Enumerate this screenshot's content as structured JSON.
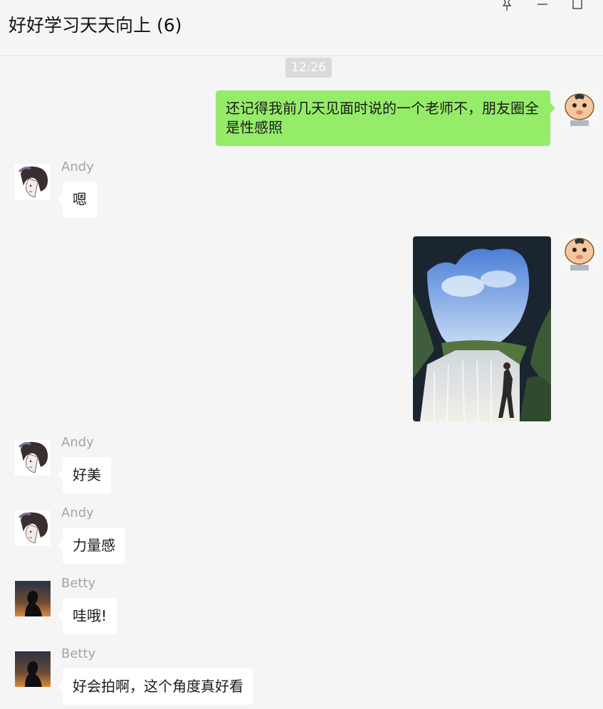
{
  "chat": {
    "title": "好好学习天天向上 (6)"
  },
  "window_controls": [
    "pin-icon",
    "minimize-icon",
    "maximize-icon"
  ],
  "timestamp": "12:26",
  "messages": [
    {
      "sender": "",
      "side": "right",
      "text": "还记得我前几天见面时说的一个老师不，朋友圈全是性感照"
    },
    {
      "sender": "Andy",
      "side": "left",
      "text": "嗯"
    },
    {
      "sender": "",
      "side": "right",
      "type": "image"
    },
    {
      "sender": "Andy",
      "side": "left",
      "text": "好美"
    },
    {
      "sender": "Andy",
      "side": "left",
      "text": "力量感"
    },
    {
      "sender": "Betty",
      "side": "left",
      "text": "哇哦!"
    },
    {
      "sender": "Betty",
      "side": "left",
      "text": "好会拍啊，这个角度真好看"
    }
  ],
  "colors": {
    "self_bubble": "#95ec69",
    "other_bubble": "#ffffff",
    "background": "#f5f5f5"
  }
}
